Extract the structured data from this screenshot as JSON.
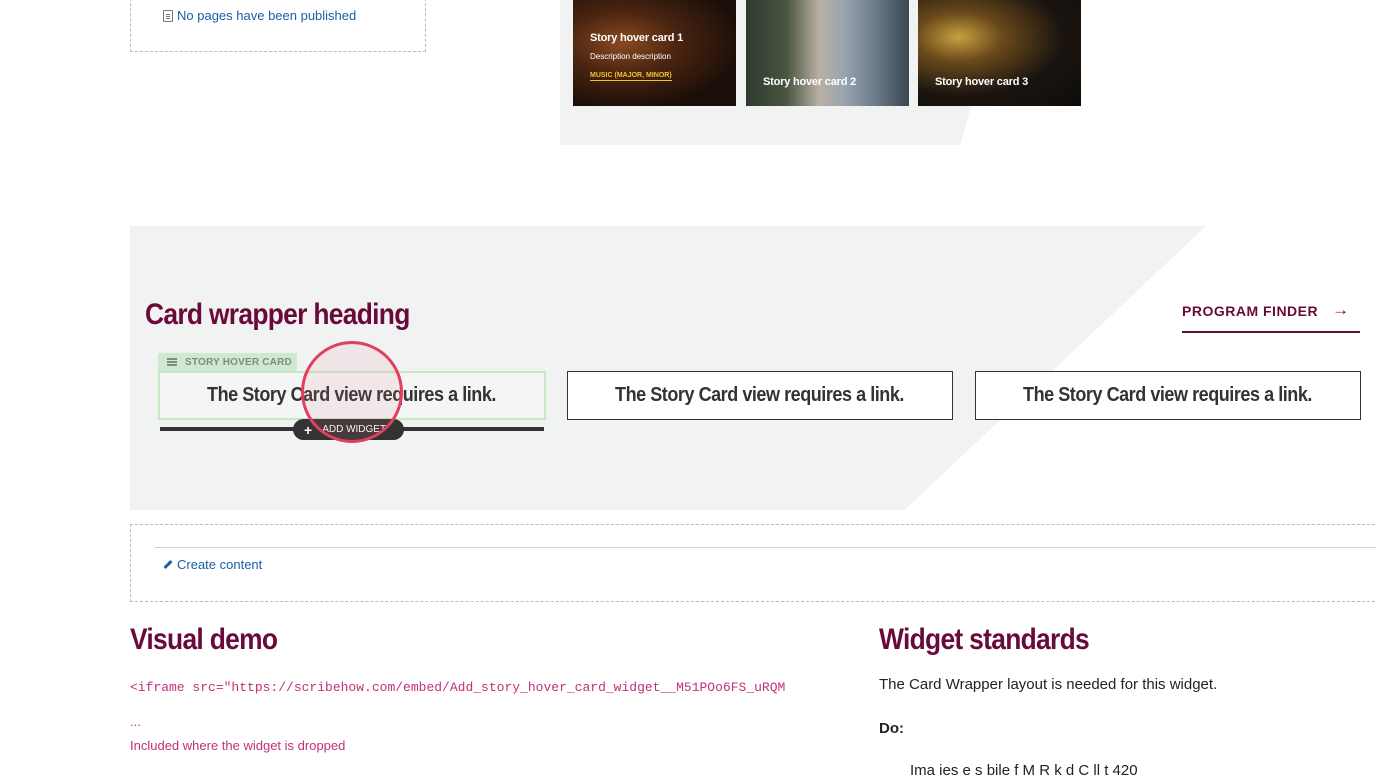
{
  "pages": {
    "link_label": "No pages have been published"
  },
  "hover_cards": [
    {
      "title": "Story hover card 1",
      "description": "Description description",
      "tag": "MUSIC (MAJOR, MINOR)"
    },
    {
      "title": "Story hover card 2"
    },
    {
      "title": "Story hover card 3"
    }
  ],
  "card_wrapper": {
    "heading": "Card wrapper heading",
    "program_finder": "PROGRAM FINDER",
    "widget_label": "STORY HOVER CARD",
    "story_message": "The Story Card view requires a link.",
    "add_widget": "ADD WIDGET"
  },
  "create": {
    "link_label": "Create content"
  },
  "visual_demo": {
    "title": "Visual demo",
    "code": "<iframe src=\"https://scribehow.com/embed/Add_story_hover_card_widget__M51POo6FS_uRQM",
    "ellipsis": "...",
    "note": "Included where the widget is dropped"
  },
  "widget_standards": {
    "title": "Widget standards",
    "text": "The Card Wrapper layout is needed for this widget.",
    "do_label": "Do:",
    "cut_line": "Ima  ies  e  s  bile f M  R  k  d C ll  t 420"
  },
  "colors": {
    "brand": "#6a0a3a",
    "link": "#1a5fa8",
    "code": "#c2307a",
    "accent": "#f2c230"
  }
}
